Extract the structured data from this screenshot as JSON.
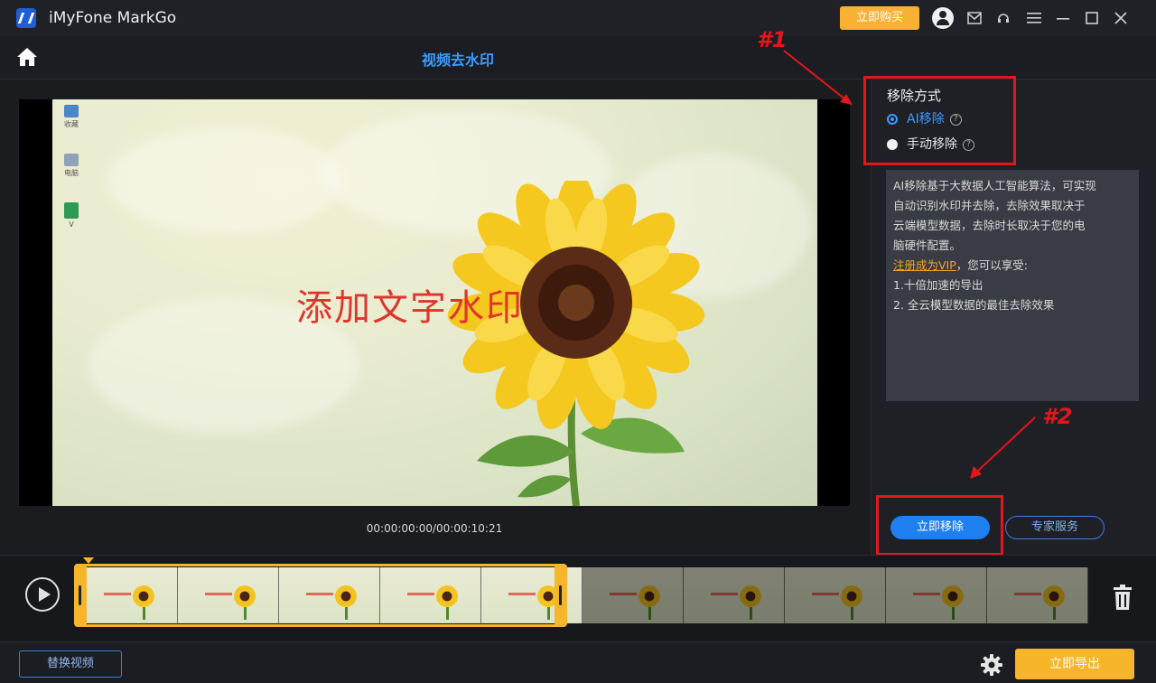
{
  "titlebar": {
    "app_name": "iMyFone MarkGo",
    "buy_label": "立即购买",
    "icons": [
      "user-icon",
      "mail-icon",
      "support-icon",
      "menu-icon",
      "minimize-icon",
      "maximize-icon",
      "close-icon"
    ]
  },
  "header": {
    "title": "视频去水印"
  },
  "video": {
    "watermark_text": "添加文字水印",
    "desktop_icons": [
      "收藏",
      "电脑",
      "V"
    ],
    "timecode": "00:00:00:00/00:00:10:21"
  },
  "panel": {
    "section_title": "移除方式",
    "options": [
      {
        "label": "AI移除",
        "selected": true
      },
      {
        "label": "手动移除",
        "selected": false
      }
    ],
    "description_lines": [
      "AI移除基于大数据人工智能算法，可实现",
      "自动识别水印并去除，去除效果取决于",
      "云端模型数据，去除时长取决于您的电",
      "脑硬件配置。"
    ],
    "vip_link": "注册成为VIP",
    "vip_suffix": "，您可以享受:",
    "benefits": [
      "1.十倍加速的导出",
      "2. 全云模型数据的最佳去除效果"
    ],
    "start_label": "立即移除",
    "expert_label": "专家服务"
  },
  "annotations": {
    "mark1": "#1",
    "mark2": "#2"
  },
  "footer": {
    "replace_label": "替换视频",
    "export_label": "立即导出"
  },
  "colors": {
    "accent_blue": "#1e7ff0",
    "accent_orange": "#f7b52b",
    "annotation_red": "#e4161b",
    "watermark_red": "#e0352b"
  }
}
